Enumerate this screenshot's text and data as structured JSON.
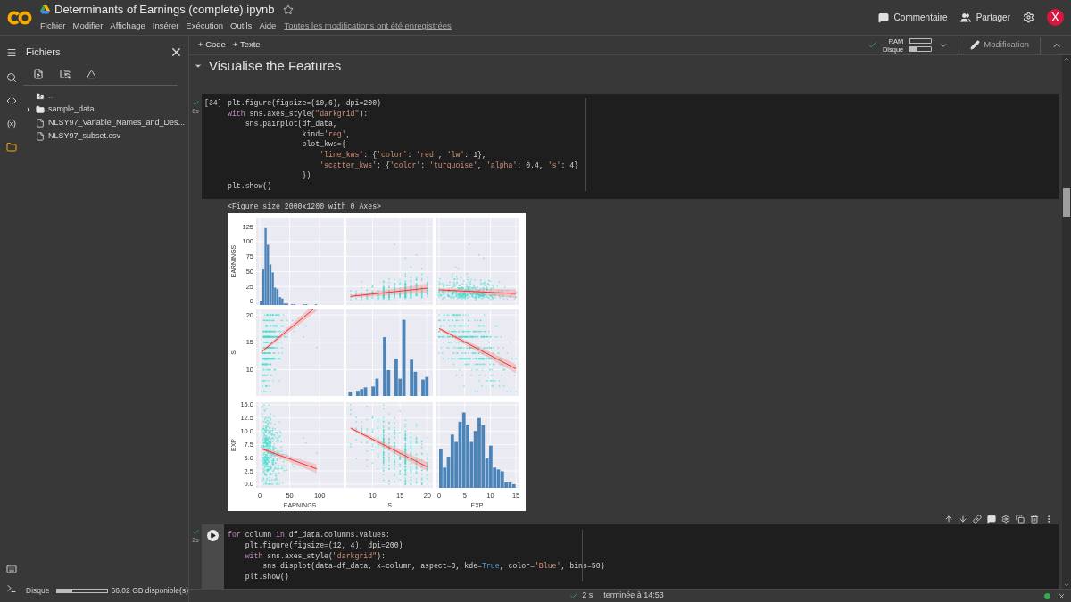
{
  "header": {
    "title": "Determinants of Earnings (complete).ipynb",
    "starred": false,
    "menu": [
      "Fichier",
      "Modifier",
      "Affichage",
      "Insérer",
      "Exécution",
      "Outils",
      "Aide"
    ],
    "save_status": "Toutes les modifications ont été enregistrées",
    "actions": [
      {
        "label": "Commentaire",
        "kind": "comment"
      },
      {
        "label": "Partager",
        "kind": "share"
      }
    ],
    "avatar_letter": "X"
  },
  "sidebar": {
    "title": "Fichiers",
    "rail": [
      {
        "kind": "search",
        "selected": false
      },
      {
        "kind": "code",
        "selected": false
      },
      {
        "kind": "variables",
        "selected": false
      },
      {
        "kind": "files",
        "selected": true
      }
    ],
    "files": [
      {
        "name": "..",
        "kind": "up"
      },
      {
        "name": "sample_data",
        "kind": "folder",
        "expanded": false
      },
      {
        "name": "NLSY97_Variable_Names_and_Des...",
        "kind": "file"
      },
      {
        "name": "NLSY97_subset.csv",
        "kind": "file"
      }
    ],
    "disk": {
      "label": "Disque",
      "level": 0.3,
      "text": "66.02 GB disponible(s)"
    }
  },
  "toolbar": {
    "add_buttons": [
      "+ Code",
      "+ Texte"
    ],
    "connected": true,
    "ram": {
      "label": "RAM",
      "level": 0.05
    },
    "disk": {
      "label": "Disque",
      "level": 0.35
    },
    "mode": "Modification"
  },
  "section": {
    "title": "Visualise the Features",
    "expanded": true
  },
  "cells": [
    {
      "prompt": "[34]",
      "duration": "6s",
      "focused": false,
      "lines": [
        [
          {
            "kind": "plain",
            "text": "plt.figure(figsize=(10,6), dpi=200)"
          }
        ],
        [
          {
            "kind": "kw",
            "text": "with"
          },
          {
            "kind": "plain",
            "text": " sns.axes_style("
          },
          {
            "kind": "str",
            "text": "\"darkgrid\""
          },
          {
            "kind": "plain",
            "text": "):"
          }
        ],
        [
          {
            "kind": "plain",
            "text": "    sns.pairplot(df_data,"
          }
        ],
        [
          {
            "kind": "plain",
            "text": "                 kind="
          },
          {
            "kind": "str",
            "text": "'reg'"
          },
          {
            "kind": "plain",
            "text": ","
          }
        ],
        [
          {
            "kind": "plain",
            "text": "                 plot_kws={"
          }
        ],
        [
          {
            "kind": "str",
            "text": "                     'line_kws'"
          },
          {
            "kind": "plain",
            "text": ": {"
          },
          {
            "kind": "str",
            "text": "'color'"
          },
          {
            "kind": "plain",
            "text": ": "
          },
          {
            "kind": "str",
            "text": "'red'"
          },
          {
            "kind": "plain",
            "text": ", "
          },
          {
            "kind": "str",
            "text": "'lw'"
          },
          {
            "kind": "plain",
            "text": ": 1},"
          }
        ],
        [
          {
            "kind": "str",
            "text": "                     'scatter_kws'"
          },
          {
            "kind": "plain",
            "text": ": {"
          },
          {
            "kind": "str",
            "text": "'color'"
          },
          {
            "kind": "plain",
            "text": ": "
          },
          {
            "kind": "str",
            "text": "'turquoise'"
          },
          {
            "kind": "plain",
            "text": ", "
          },
          {
            "kind": "str",
            "text": "'alpha'"
          },
          {
            "kind": "plain",
            "text": ": 0.4, "
          },
          {
            "kind": "str",
            "text": "'s'"
          },
          {
            "kind": "plain",
            "text": ": 4}"
          }
        ],
        [
          {
            "kind": "plain",
            "text": "                 })"
          }
        ],
        [
          {
            "kind": "plain",
            "text": "plt.show()"
          }
        ]
      ],
      "output": {
        "text": "<Figure size 2000x1200 with 0 Axes>",
        "variables": [
          {
            "name": "EARNINGS",
            "x_label": "EARNINGS",
            "ticks": [
              "125",
              "100",
              "75",
              "50",
              "25",
              "0"
            ],
            "x_ticks": [
              "0",
              "50",
              "100"
            ]
          },
          {
            "name": "S",
            "x_label": "S",
            "ticks": [
              "20",
              "15",
              "10"
            ],
            "x_ticks": [
              "10",
              "15",
              "20"
            ]
          },
          {
            "name": "EXP",
            "x_label": "EXP",
            "ticks": [
              "15.0",
              "12.5",
              "10.0",
              "7.5",
              "5.0",
              "2.5",
              "0.0"
            ],
            "x_ticks": [
              "0",
              "5",
              "10",
              "15"
            ]
          }
        ]
      }
    },
    {
      "duration": "2s",
      "focused": true,
      "lines": [
        [
          {
            "kind": "kw",
            "text": "for"
          },
          {
            "kind": "plain",
            "text": " column "
          },
          {
            "kind": "kw",
            "text": "in"
          },
          {
            "kind": "plain",
            "text": " df_data.columns.values:"
          }
        ],
        [
          {
            "kind": "plain",
            "text": "    plt.figure(figsize=(12, 4), dpi=200)"
          }
        ],
        [
          {
            "kind": "kw",
            "text": "    with"
          },
          {
            "kind": "plain",
            "text": " sns.axes_style("
          },
          {
            "kind": "str",
            "text": "\"darkgrid\""
          },
          {
            "kind": "plain",
            "text": "):"
          }
        ],
        [
          {
            "kind": "plain",
            "text": "        sns.displot(data=df_data, x=column, aspect=3, kde="
          },
          {
            "kind": "const",
            "text": "True"
          },
          {
            "kind": "plain",
            "text": ", color="
          },
          {
            "kind": "str",
            "text": "'Blue'"
          },
          {
            "kind": "plain",
            "text": ", bins=50)"
          }
        ],
        [
          {
            "kind": "plain",
            "text": "    plt.show()"
          }
        ]
      ]
    }
  ],
  "status_bar": {
    "done": true,
    "duration": "2 s",
    "text": "terminée à 14:53",
    "connected": true
  }
}
